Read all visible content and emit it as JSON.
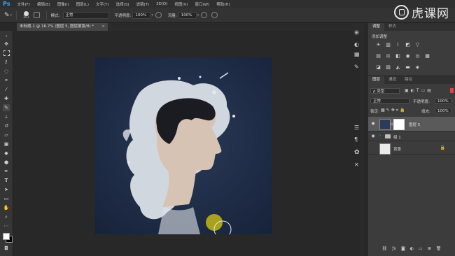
{
  "app": {
    "logo": "Ps"
  },
  "menu": [
    "文件(F)",
    "编辑(E)",
    "图像(I)",
    "图层(L)",
    "文字(Y)",
    "选择(S)",
    "滤镜(T)",
    "3D(D)",
    "视图(V)",
    "窗口(W)",
    "帮助(H)"
  ],
  "brand": {
    "text": "虎课网"
  },
  "options": {
    "brush_size": "351",
    "mode_label": "模式:",
    "mode_value": "正常",
    "opacity_label": "不透明度:",
    "opacity_value": "100%",
    "flow_label": "流量:",
    "flow_value": "100%"
  },
  "document": {
    "tab_title": "未标题-1 @ 16.7% (图层 5, 图层蒙版/8) *",
    "close": "×"
  },
  "adjustments": {
    "tabs": [
      "调整",
      "样式"
    ],
    "title": "添加调整"
  },
  "layers_panel": {
    "tabs": [
      "图层",
      "通道",
      "路径"
    ],
    "filter_label": "ρ 类型",
    "blend_mode": "正常",
    "opacity_label": "不透明度:",
    "opacity_value": "100%",
    "lock_label": "锁定:",
    "fill_label": "填充:",
    "fill_value": "100%",
    "layers": [
      {
        "name": "图层 5"
      },
      {
        "name": "组 1"
      },
      {
        "name": "背景"
      }
    ]
  },
  "colors": {
    "accent": "#31a8ff",
    "canvas_bg": "#1f2c43",
    "splash": "#e4e8ec",
    "yellow_circle": "#aaa21c"
  }
}
